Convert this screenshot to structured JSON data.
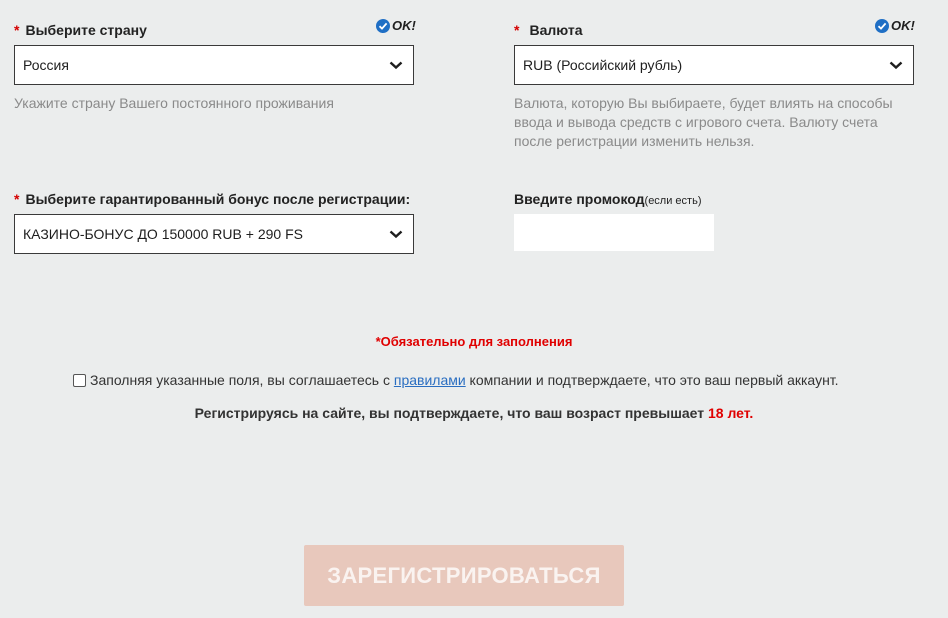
{
  "country": {
    "required_mark": "*",
    "label": "Выберите страну",
    "ok_text": "OK!",
    "selected": "Россия",
    "hint": "Укажите страну Вашего постоянного проживания"
  },
  "currency": {
    "required_mark": "*",
    "label": "Валюта",
    "ok_text": "OK!",
    "selected": "RUB (Российский рубль)",
    "hint_lines": [
      "Валюта, которую Вы выбираете, будет влиять на способы",
      "ввода и вывода средств с игрового счета. Валюту счета",
      "после регистрации изменить нельзя."
    ]
  },
  "bonus": {
    "required_mark": "*",
    "label": "Выберите гарантированный бонус после регистрации:",
    "selected": "КАЗИНО-БОНУС ДО 150000 RUB + 290 FS"
  },
  "promo": {
    "label": "Введите промокод",
    "label_note": "(если есть)",
    "value": ""
  },
  "required_note": "*Обязательно для заполнения",
  "agreement": {
    "checked": false,
    "text_before": "Заполняя указанные поля, вы соглашаетесь с ",
    "link_text": "правилами",
    "text_after": " компании и подтверждаете, что это ваш первый аккаунт."
  },
  "age_notice": {
    "text": "Регистрируясь на сайте, вы подтверждаете, что ваш возраст превышает ",
    "highlight": "18 лет."
  },
  "register_button": {
    "label": "ЗАРЕГИСТРИРОВАТЬСЯ"
  },
  "icons": {
    "ok": "check-circle-icon",
    "dropdown": "chevron-down-icon"
  },
  "colors": {
    "background": "#ebeded",
    "required": "#d40000",
    "link": "#2a6ec1",
    "ok_check": "#1f6fc5",
    "button_bg": "#e8c8bc",
    "hint_text": "#8a8a8a"
  }
}
